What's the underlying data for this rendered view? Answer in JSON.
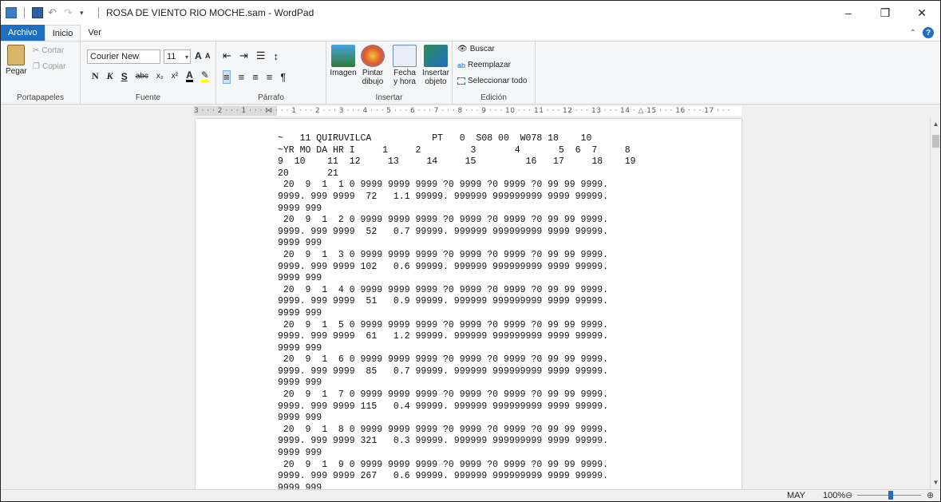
{
  "window": {
    "title": "ROSA DE VIENTO RIO MOCHE.sam - WordPad",
    "controls": {
      "minimize": "–",
      "maximize": "❐",
      "close": "✕"
    }
  },
  "tabs": [
    "Archivo",
    "Inicio",
    "Ver"
  ],
  "ribbon": {
    "clipboard": {
      "paste": "Pegar",
      "cut": "Cortar",
      "copy": "Copiar",
      "group": "Portapapeles"
    },
    "font": {
      "family": "Courier New",
      "size": "11",
      "group": "Fuente",
      "bold": "N",
      "italic": "K",
      "underline": "S",
      "strike": "abc",
      "sub": "x₂",
      "sup": "x²",
      "grow": "A",
      "shrink": "A"
    },
    "paragraph": {
      "group": "Párrafo"
    },
    "insert": {
      "image": "Imagen",
      "paint": "Pintar\ndibujo",
      "datetime": "Fecha\ny hora",
      "object": "Insertar\nobjeto",
      "group": "Insertar"
    },
    "edit": {
      "find": "Buscar",
      "replace": "Reemplazar",
      "selectall": "Seleccionar todo",
      "group": "Edición"
    }
  },
  "ruler": "3 · · · 2 · · · 1 · · · ⋈ · · · 1 · · · 2 · · · 3 · · · 4 · · · 5 · · · 6 · · · 7 · · · 8 · · · 9 · · · 10 · · · 11 · · · 12 · · · 13 · · · 14 · △ 15 · · · 16 · · · 17 · · ·",
  "document": {
    "lines": [
      "~   11 QUIRUVILCA           PT   0  S08 00  W078 18    10",
      "~YR MO DA HR I     1     2         3       4       5  6  7     8",
      "9  10    11  12     13     14     15         16   17     18    19",
      "20       21",
      " 20  9  1  1 0 9999 9999 9999 ?0 9999 ?0 9999 ?0 99 99 9999.",
      "9999. 999 9999  72   1.1 99999. 999999 999999999 9999 99999.",
      "9999 999",
      " 20  9  1  2 0 9999 9999 9999 ?0 9999 ?0 9999 ?0 99 99 9999.",
      "9999. 999 9999  52   0.7 99999. 999999 999999999 9999 99999.",
      "9999 999",
      " 20  9  1  3 0 9999 9999 9999 ?0 9999 ?0 9999 ?0 99 99 9999.",
      "9999. 999 9999 102   0.6 99999. 999999 999999999 9999 99999.",
      "9999 999",
      " 20  9  1  4 0 9999 9999 9999 ?0 9999 ?0 9999 ?0 99 99 9999.",
      "9999. 999 9999  51   0.9 99999. 999999 999999999 9999 99999.",
      "9999 999",
      " 20  9  1  5 0 9999 9999 9999 ?0 9999 ?0 9999 ?0 99 99 9999.",
      "9999. 999 9999  61   1.2 99999. 999999 999999999 9999 99999.",
      "9999 999",
      " 20  9  1  6 0 9999 9999 9999 ?0 9999 ?0 9999 ?0 99 99 9999.",
      "9999. 999 9999  85   0.7 99999. 999999 999999999 9999 99999.",
      "9999 999",
      " 20  9  1  7 0 9999 9999 9999 ?0 9999 ?0 9999 ?0 99 99 9999.",
      "9999. 999 9999 115   0.4 99999. 999999 999999999 9999 99999.",
      "9999 999",
      " 20  9  1  8 0 9999 9999 9999 ?0 9999 ?0 9999 ?0 99 99 9999.",
      "9999. 999 9999 321   0.3 99999. 999999 999999999 9999 99999.",
      "9999 999",
      " 20  9  1  9 0 9999 9999 9999 ?0 9999 ?0 9999 ?0 99 99 9999.",
      "9999. 999 9999 267   0.6 99999. 999999 999999999 9999 99999.",
      "9999 999"
    ]
  },
  "status": {
    "caps": "MAY",
    "zoom": "100%",
    "zoom_out": "⊖",
    "zoom_in": "⊕"
  },
  "colors": {
    "accent": "#1e6fc1"
  }
}
